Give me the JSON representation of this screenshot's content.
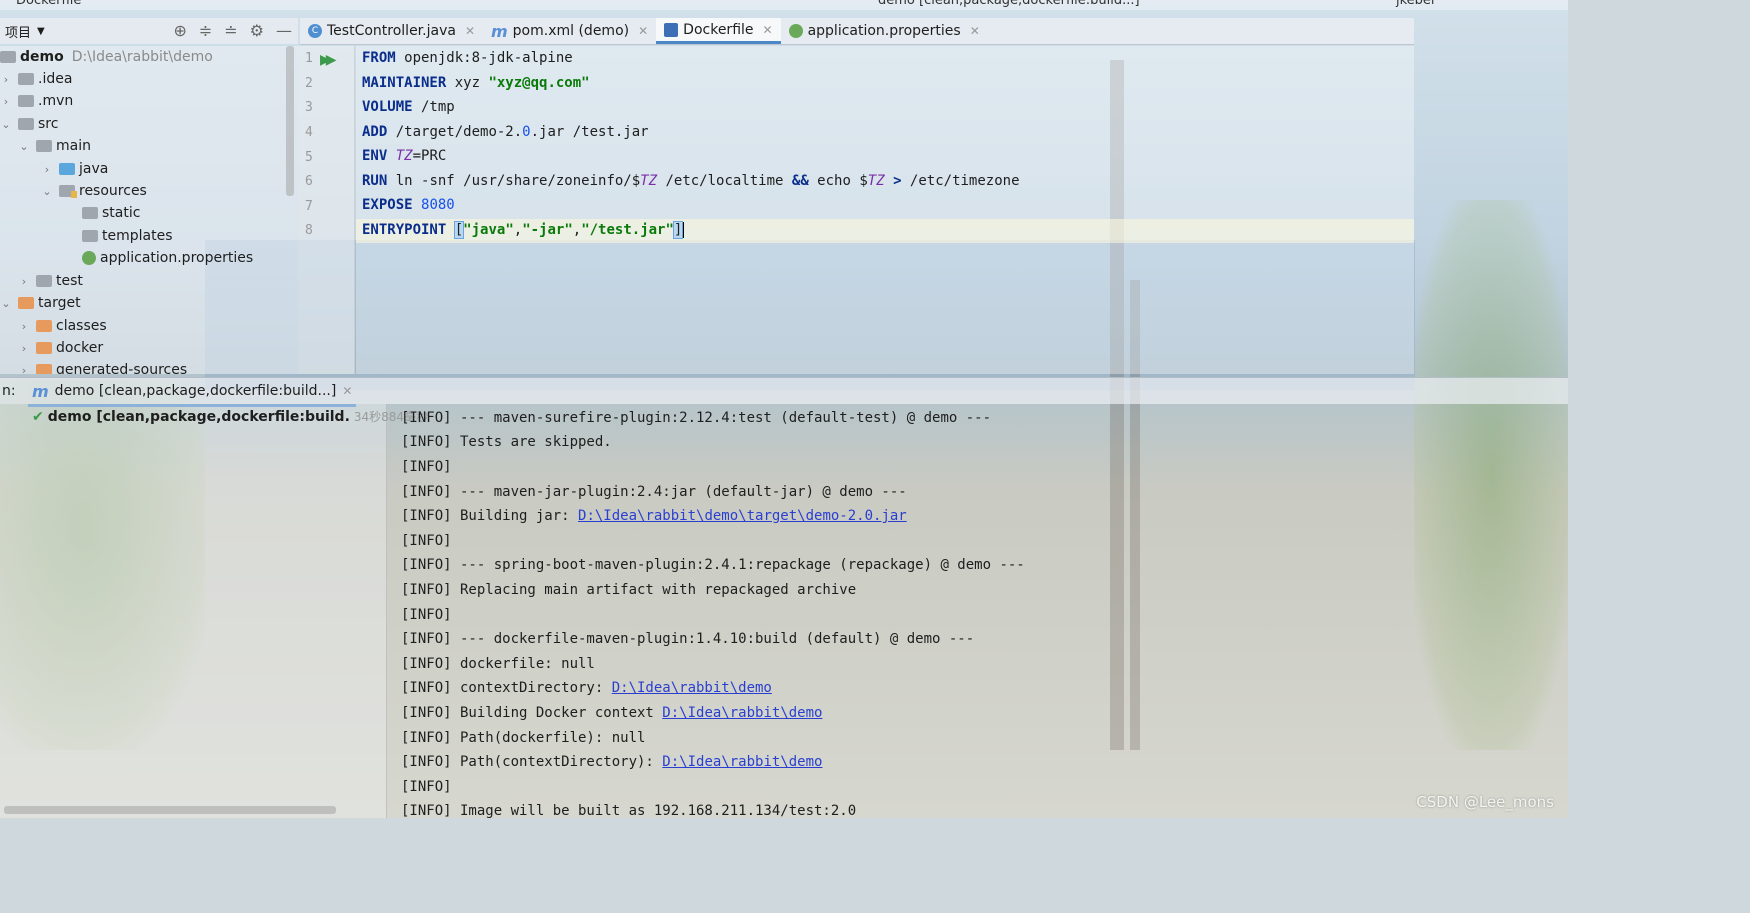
{
  "window": {
    "title": "Dockerfile",
    "run_config": "demo [clean,package,dockerfile:build...]",
    "branch": "jkebei"
  },
  "project": {
    "view_label": "项目",
    "root": {
      "name": "demo",
      "path": "D:\\Idea\\rabbit\\demo"
    },
    "nodes": [
      ".idea",
      ".mvn",
      "src",
      "main",
      "java",
      "resources",
      "static",
      "templates",
      "application.properties",
      "test",
      "target",
      "classes",
      "docker",
      "generated-sources"
    ]
  },
  "editor": {
    "tabs": [
      {
        "label": "TestController.java",
        "icon": "class-icon"
      },
      {
        "label": "pom.xml (demo)",
        "icon": "maven-icon"
      },
      {
        "label": "Dockerfile",
        "icon": "docker-icon"
      },
      {
        "label": "application.properties",
        "icon": "spring-leaf-icon"
      }
    ],
    "active_tab": "Dockerfile",
    "line_numbers": [
      "1",
      "2",
      "3",
      "4",
      "5",
      "6",
      "7",
      "8"
    ],
    "code": {
      "l1": {
        "kw": "FROM",
        "text": " openjdk:8-jdk-alpine"
      },
      "l2": {
        "kw": "MAINTAINER",
        "text": " xyz ",
        "str": "\"xyz@qq.com\""
      },
      "l3": {
        "kw": "VOLUME",
        "text": " /tmp"
      },
      "l4": {
        "kw": "ADD",
        "a": " /target/demo-2.",
        "num": "0",
        "b": ".jar /test.jar"
      },
      "l5": {
        "kw": "ENV",
        "var": "TZ",
        "b": "=PRC"
      },
      "l6": {
        "kw": "RUN",
        "a": " ln -snf /usr/share/zoneinfo/$",
        "var1": "TZ",
        "b": " /etc/localtime ",
        "amp": "&&",
        "c": " echo $",
        "var2": "TZ",
        "d": " ",
        "gt": ">",
        "e": " /etc/timezone"
      },
      "l7": {
        "kw": "EXPOSE",
        "num": "8080"
      },
      "l8": {
        "kw": "ENTRYPOINT",
        "open": "[",
        "s1": "\"java\"",
        "c1": ",",
        "s2": "\"-jar\"",
        "c2": ",",
        "s3": "\"/test.jar\"",
        "close": "]"
      }
    }
  },
  "run": {
    "label": "n:",
    "tab_label": "demo [clean,package,dockerfile:build...]",
    "tree_item": "demo [clean,package,dockerfile:build.",
    "tree_time": "34秒884毫秒",
    "console": [
      {
        "text": "[INFO] --- maven-surefire-plugin:2.12.4:test (default-test) @ demo ---"
      },
      {
        "text": "[INFO] Tests are skipped."
      },
      {
        "text": "[INFO]"
      },
      {
        "text": "[INFO] --- maven-jar-plugin:2.4:jar (default-jar) @ demo ---"
      },
      {
        "text": "[INFO] Building jar: ",
        "link": "D:\\Idea\\rabbit\\demo\\target\\demo-2.0.jar"
      },
      {
        "text": "[INFO]"
      },
      {
        "text": "[INFO] --- spring-boot-maven-plugin:2.4.1:repackage (repackage) @ demo ---"
      },
      {
        "text": "[INFO] Replacing main artifact with repackaged archive"
      },
      {
        "text": "[INFO]"
      },
      {
        "text": "[INFO] --- dockerfile-maven-plugin:1.4.10:build (default) @ demo ---"
      },
      {
        "text": "[INFO] dockerfile: null"
      },
      {
        "text": "[INFO] contextDirectory: ",
        "link": "D:\\Idea\\rabbit\\demo"
      },
      {
        "text": "[INFO] Building Docker context ",
        "link": "D:\\Idea\\rabbit\\demo"
      },
      {
        "text": "[INFO] Path(dockerfile): null"
      },
      {
        "text": "[INFO] Path(contextDirectory): ",
        "link": "D:\\Idea\\rabbit\\demo"
      },
      {
        "text": "[INFO]"
      },
      {
        "text": "[INFO] Image will be built as 192.168.211.134/test:2.0"
      }
    ]
  },
  "watermark": "CSDN @Lee_mons"
}
